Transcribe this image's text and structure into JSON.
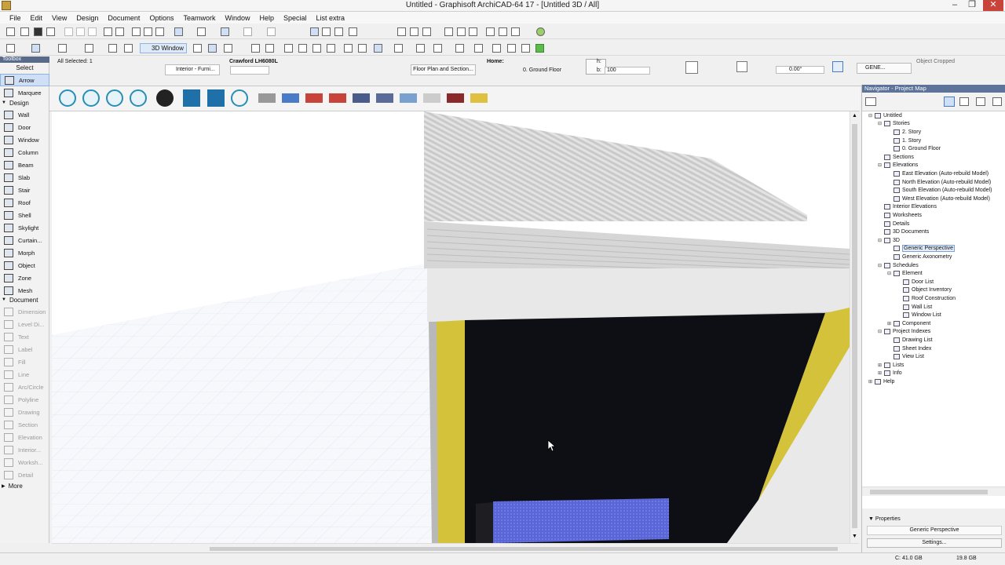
{
  "window": {
    "title": "Untitled - Graphisoft ArchiCAD-64 17 - [Untitled 3D / All]",
    "minimize": "–",
    "restore": "❐",
    "close": "✕"
  },
  "menu": [
    "File",
    "Edit",
    "View",
    "Design",
    "Document",
    "Options",
    "Teamwork",
    "Window",
    "Help",
    "Special",
    "List extra"
  ],
  "toolbar": {
    "view_3d_label": "3D Window"
  },
  "infobox": {
    "all_selected": "All Selected: 1",
    "object_name": "Crawford LH6080L",
    "interior_label": "Interior - Furni...",
    "floor_plan_section": "Floor Plan and Section...",
    "home_label": "Home:",
    "home_value": "0. Ground Floor",
    "h_label": "h:",
    "b_label": "b:",
    "b_value": "100",
    "angle_value": "0.00°",
    "gene_label": "GENE...",
    "object_cropped": "Object Cropped"
  },
  "toolbox": {
    "title": "Toolbox",
    "select_label": "Select",
    "tools": [
      {
        "label": "Arrow",
        "icon": "arrow-icon",
        "selected": true,
        "dim": false
      },
      {
        "label": "Marquee",
        "icon": "marquee-icon",
        "selected": false,
        "dim": false
      }
    ],
    "design_header": "Design",
    "design_tools": [
      "Wall",
      "Door",
      "Window",
      "Column",
      "Beam",
      "Slab",
      "Stair",
      "Roof",
      "Shell",
      "Skylight",
      "Curtain...",
      "Morph",
      "Object",
      "Zone",
      "Mesh"
    ],
    "document_header": "Document",
    "document_tools": [
      "Dimension",
      "Level Di...",
      "Text",
      "Label",
      "Fill",
      "Line",
      "Arc/Circle",
      "Polyline",
      "Drawing",
      "Section",
      "Elevation",
      "Interior...",
      "Worksh...",
      "Detail"
    ],
    "more_label": "More"
  },
  "strip_icons": [
    "cloud-icon",
    "info-icon",
    "cloud-icon",
    "refresh-icon",
    "gear-icon",
    "mail-icon",
    "briefcase-icon",
    "help-icon",
    "brand-logo-icon",
    "brand-logo-icon",
    "velux-logo-icon",
    "brand-logo-icon",
    "york-logo-icon",
    "brand-logo-icon",
    "brand-logo-icon",
    "brand-logo-icon",
    "dorma-logo-icon",
    "brand-logo-icon"
  ],
  "navigator": {
    "title": "Navigator - Project Map",
    "tree": [
      {
        "label": "Untitled",
        "depth": 0,
        "tw": "⊟"
      },
      {
        "label": "Stories",
        "depth": 1,
        "tw": "⊟"
      },
      {
        "label": "2. Story",
        "depth": 2,
        "tw": ""
      },
      {
        "label": "1. Story",
        "depth": 2,
        "tw": ""
      },
      {
        "label": "0. Ground Floor",
        "depth": 2,
        "tw": ""
      },
      {
        "label": "Sections",
        "depth": 1,
        "tw": ""
      },
      {
        "label": "Elevations",
        "depth": 1,
        "tw": "⊟"
      },
      {
        "label": "East Elevation (Auto-rebuild Model)",
        "depth": 2,
        "tw": ""
      },
      {
        "label": "North Elevation (Auto-rebuild Model)",
        "depth": 2,
        "tw": ""
      },
      {
        "label": "South Elevation (Auto-rebuild Model)",
        "depth": 2,
        "tw": ""
      },
      {
        "label": "West Elevation (Auto-rebuild Model)",
        "depth": 2,
        "tw": ""
      },
      {
        "label": "Interior Elevations",
        "depth": 1,
        "tw": ""
      },
      {
        "label": "Worksheets",
        "depth": 1,
        "tw": ""
      },
      {
        "label": "Details",
        "depth": 1,
        "tw": ""
      },
      {
        "label": "3D Documents",
        "depth": 1,
        "tw": ""
      },
      {
        "label": "3D",
        "depth": 1,
        "tw": "⊟"
      },
      {
        "label": "Generic Perspective",
        "depth": 2,
        "tw": "",
        "selected": true
      },
      {
        "label": "Generic Axonometry",
        "depth": 2,
        "tw": ""
      },
      {
        "label": "Schedules",
        "depth": 1,
        "tw": "⊟"
      },
      {
        "label": "Element",
        "depth": 2,
        "tw": "⊟"
      },
      {
        "label": "Door List",
        "depth": 3,
        "tw": ""
      },
      {
        "label": "Object Inventory",
        "depth": 3,
        "tw": ""
      },
      {
        "label": "Roof Construction",
        "depth": 3,
        "tw": ""
      },
      {
        "label": "Wall List",
        "depth": 3,
        "tw": ""
      },
      {
        "label": "Window List",
        "depth": 3,
        "tw": ""
      },
      {
        "label": "Component",
        "depth": 2,
        "tw": "⊞"
      },
      {
        "label": "Project Indexes",
        "depth": 1,
        "tw": "⊟"
      },
      {
        "label": "Drawing List",
        "depth": 2,
        "tw": ""
      },
      {
        "label": "Sheet Index",
        "depth": 2,
        "tw": ""
      },
      {
        "label": "View List",
        "depth": 2,
        "tw": ""
      },
      {
        "label": "Lists",
        "depth": 1,
        "tw": "⊞"
      },
      {
        "label": "Info",
        "depth": 1,
        "tw": "⊞"
      },
      {
        "label": "Help",
        "depth": 0,
        "tw": "⊞"
      }
    ]
  },
  "properties": {
    "header": "Properties",
    "name": "Generic Perspective",
    "settings_button": "Settings..."
  },
  "status": {
    "disk_c": "C: 41.0 GB",
    "memory": "19.8 GB"
  },
  "colors": {
    "accent": "#5d7399",
    "door_frame_yellow": "#d4c23a",
    "door_opening": "#0d0f14",
    "blue_furniture": "#5562d6"
  }
}
